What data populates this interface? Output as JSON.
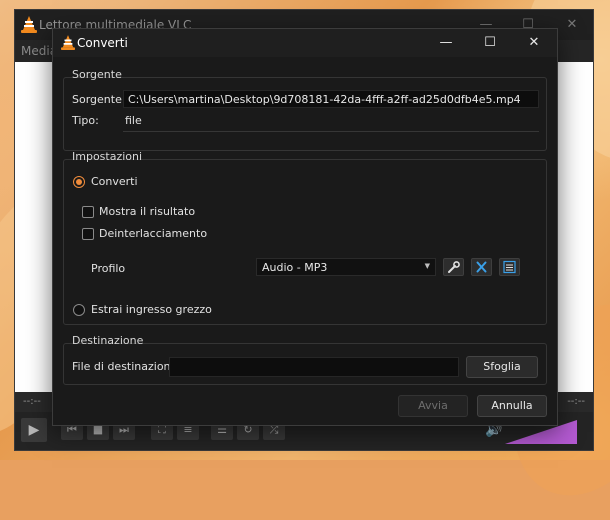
{
  "vlc_window": {
    "title": "Lettore multimediale VLC",
    "menu_media": "Media",
    "time_elapsed": "--:--",
    "time_total": "--:--",
    "volume_percent": "100%",
    "volume_level": 1.0
  },
  "dialog": {
    "title": "Converti",
    "source_group": {
      "label": "Sorgente",
      "source_label": "Sorgente:",
      "source_value": "C:\\Users\\martina\\Desktop\\9d708181-42da-4fff-a2ff-ad25d0dfb4e5.mp4",
      "type_label": "Tipo:",
      "type_value": "file"
    },
    "settings_group": {
      "label": "Impostazioni",
      "convert_option": "Converti",
      "show_output": "Mostra il risultato",
      "deinterlace": "Deinterlacciamento",
      "profile_label": "Profilo",
      "profile_value": "Audio - MP3",
      "raw_input_option": "Estrai ingresso grezzo"
    },
    "destination_group": {
      "label": "Destinazione",
      "file_label": "File di destinazione:",
      "file_value": "",
      "browse_button": "Sfoglia"
    },
    "buttons": {
      "start": "Avvia",
      "cancel": "Annulla"
    }
  },
  "colors": {
    "accent": "#f08c3c",
    "delete_icon": "#3aa0e8",
    "volume": "#b45ad2"
  }
}
